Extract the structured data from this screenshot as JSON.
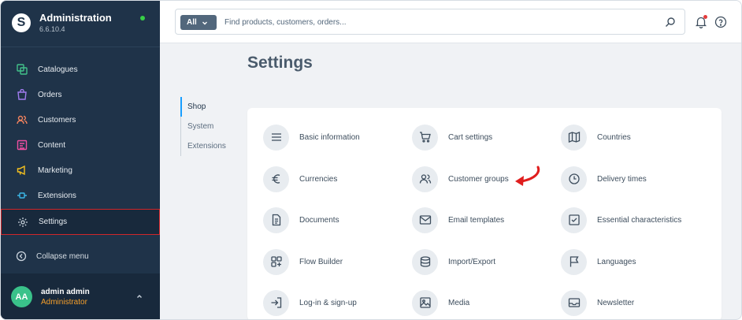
{
  "sidebar": {
    "title": "Administration",
    "version": "6.6.10.4",
    "items": [
      {
        "label": "Catalogues",
        "icon": "catalogues-icon",
        "color": "#42c18a"
      },
      {
        "label": "Orders",
        "icon": "orders-icon",
        "color": "#a07cf0"
      },
      {
        "label": "Customers",
        "icon": "customers-icon",
        "color": "#f0825e"
      },
      {
        "label": "Content",
        "icon": "content-icon",
        "color": "#ef4fa2"
      },
      {
        "label": "Marketing",
        "icon": "marketing-icon",
        "color": "#f5c11e"
      },
      {
        "label": "Extensions",
        "icon": "extensions-icon",
        "color": "#3cb8e8"
      },
      {
        "label": "Settings",
        "icon": "settings-icon",
        "color": "#c8d2dc"
      }
    ],
    "collapse_label": "Collapse menu",
    "user": {
      "initials": "AA",
      "name": "admin admin",
      "role": "Administrator"
    }
  },
  "search": {
    "type_label": "All",
    "placeholder": "Find products, customers, orders..."
  },
  "page": {
    "title": "Settings"
  },
  "subnav": {
    "items": [
      "Shop",
      "System",
      "Extensions"
    ],
    "active": "Shop"
  },
  "tiles": [
    {
      "label": "Basic information",
      "icon": "list-icon"
    },
    {
      "label": "Cart settings",
      "icon": "cart-icon"
    },
    {
      "label": "Countries",
      "icon": "map-icon"
    },
    {
      "label": "Currencies",
      "icon": "euro-icon"
    },
    {
      "label": "Customer groups",
      "icon": "users-icon"
    },
    {
      "label": "Delivery times",
      "icon": "clock-icon"
    },
    {
      "label": "Documents",
      "icon": "document-icon"
    },
    {
      "label": "Email templates",
      "icon": "envelope-icon"
    },
    {
      "label": "Essential characteristics",
      "icon": "checkbox-icon"
    },
    {
      "label": "Flow Builder",
      "icon": "flow-icon"
    },
    {
      "label": "Import/Export",
      "icon": "database-icon"
    },
    {
      "label": "Languages",
      "icon": "flag-icon"
    },
    {
      "label": "Log-in & sign-up",
      "icon": "login-icon"
    },
    {
      "label": "Media",
      "icon": "image-icon"
    },
    {
      "label": "Newsletter",
      "icon": "inbox-icon"
    }
  ],
  "colors": {
    "sidebar_bg": "#1f3349",
    "accent": "#189eff",
    "highlight": "#d0262a",
    "role": "#f59f2b",
    "status": "#37d046"
  }
}
